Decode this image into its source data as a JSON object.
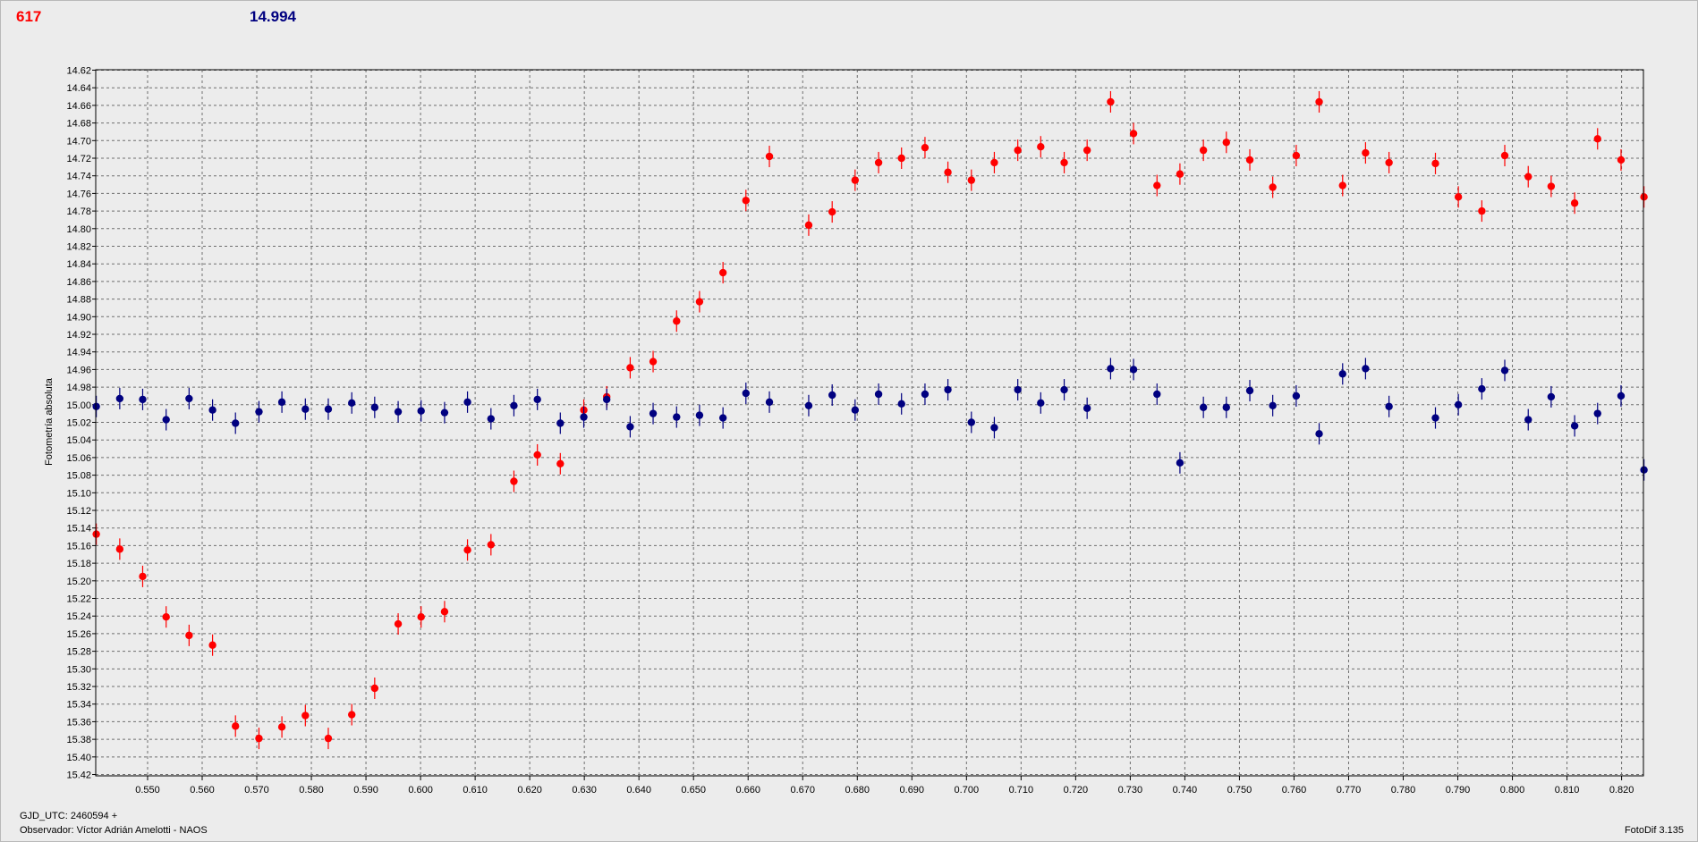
{
  "header": {
    "star_label": "617",
    "mag_label": "14.994",
    "star_color": "#ff0000",
    "mag_color": "#000080"
  },
  "footer": {
    "gjd": "GJD_UTC: 2460594 +",
    "observer": "Observador: Víctor Adrián Amelotti - NAOS",
    "software": "FotoDif 3.135"
  },
  "chart_data": {
    "type": "scatter",
    "title": "",
    "xlabel": "",
    "ylabel": "Fotometría absoluta",
    "xlim": [
      0.5405,
      0.824
    ],
    "ylim": [
      15.4215,
      14.6195
    ],
    "y_inverted": true,
    "grid": true,
    "x_ticks": [
      "0.550",
      "0.560",
      "0.570",
      "0.580",
      "0.590",
      "0.600",
      "0.610",
      "0.620",
      "0.630",
      "0.640",
      "0.650",
      "0.660",
      "0.670",
      "0.680",
      "0.690",
      "0.700",
      "0.710",
      "0.720",
      "0.730",
      "0.740",
      "0.750",
      "0.760",
      "0.770",
      "0.780",
      "0.790",
      "0.800",
      "0.810",
      "0.820"
    ],
    "y_ticks": [
      "14.62",
      "14.64",
      "14.66",
      "14.68",
      "14.70",
      "14.72",
      "14.74",
      "14.76",
      "14.78",
      "14.80",
      "14.82",
      "14.84",
      "14.86",
      "14.88",
      "14.90",
      "14.92",
      "14.94",
      "14.96",
      "14.98",
      "15.00",
      "15.02",
      "15.04",
      "15.06",
      "15.08",
      "15.10",
      "15.12",
      "15.14",
      "15.16",
      "15.18",
      "15.20",
      "15.22",
      "15.24",
      "15.26",
      "15.28",
      "15.30",
      "15.32",
      "15.34",
      "15.36",
      "15.38",
      "15.40",
      "15.42"
    ],
    "series": [
      {
        "color": "#ff0000",
        "x": [
          0.5406,
          0.5449,
          0.5491,
          0.5534,
          0.5576,
          0.5619,
          0.5661,
          0.5704,
          0.5746,
          0.5789,
          0.5831,
          0.5874,
          0.5916,
          0.5959,
          0.6001,
          0.6044,
          0.6086,
          0.6129,
          0.6171,
          0.6214,
          0.6256,
          0.6299,
          0.6341,
          0.6384,
          0.6426,
          0.6469,
          0.6511,
          0.6554,
          0.6596,
          0.6639,
          0.6711,
          0.6754,
          0.6796,
          0.6839,
          0.6881,
          0.6924,
          0.6966,
          0.7009,
          0.7051,
          0.7094,
          0.7136,
          0.7179,
          0.7221,
          0.7264,
          0.7306,
          0.7349,
          0.7391,
          0.7434,
          0.7476,
          0.7519,
          0.7561,
          0.7604,
          0.7646,
          0.7689,
          0.7731,
          0.7774,
          0.7859,
          0.7901,
          0.7944,
          0.7986,
          0.8029,
          0.8071,
          0.8114,
          0.8156,
          0.8199,
          0.8241
        ],
        "y": [
          15.147,
          15.164,
          15.195,
          15.241,
          15.262,
          15.273,
          15.365,
          15.379,
          15.366,
          15.353,
          15.379,
          15.352,
          15.322,
          15.249,
          15.241,
          15.235,
          15.165,
          15.159,
          15.087,
          15.057,
          15.067,
          15.006,
          14.991,
          14.958,
          14.951,
          14.905,
          14.883,
          14.85,
          14.768,
          14.718,
          14.796,
          14.781,
          14.745,
          14.725,
          14.72,
          14.708,
          14.736,
          14.745,
          14.725,
          14.711,
          14.707,
          14.725,
          14.711,
          14.656,
          14.692,
          14.751,
          14.738,
          14.711,
          14.702,
          14.722,
          14.753,
          14.717,
          14.656,
          14.751,
          14.714,
          14.725,
          14.726,
          14.764,
          14.78,
          14.717,
          14.741,
          14.752,
          14.771,
          14.698,
          14.722,
          14.764
        ]
      },
      {
        "color": "#000080",
        "x": [
          0.5406,
          0.5449,
          0.5491,
          0.5534,
          0.5576,
          0.5619,
          0.5661,
          0.5704,
          0.5746,
          0.5789,
          0.5831,
          0.5874,
          0.5916,
          0.5959,
          0.6001,
          0.6044,
          0.6086,
          0.6129,
          0.6171,
          0.6214,
          0.6256,
          0.6299,
          0.6341,
          0.6384,
          0.6426,
          0.6469,
          0.6511,
          0.6554,
          0.6596,
          0.6639,
          0.6711,
          0.6754,
          0.6796,
          0.6839,
          0.6881,
          0.6924,
          0.6966,
          0.7009,
          0.7051,
          0.7094,
          0.7136,
          0.7179,
          0.7221,
          0.7264,
          0.7306,
          0.7349,
          0.7391,
          0.7434,
          0.7476,
          0.7519,
          0.7561,
          0.7604,
          0.7646,
          0.7689,
          0.7731,
          0.7774,
          0.7859,
          0.7901,
          0.7944,
          0.7986,
          0.8029,
          0.8071,
          0.8114,
          0.8156,
          0.8199,
          0.8241
        ],
        "y": [
          15.002,
          14.993,
          14.994,
          15.017,
          14.993,
          15.006,
          15.021,
          15.008,
          14.997,
          15.005,
          15.005,
          14.998,
          15.003,
          15.008,
          15.007,
          15.009,
          14.997,
          15.016,
          15.001,
          14.994,
          15.021,
          15.014,
          14.994,
          15.025,
          15.01,
          15.014,
          15.012,
          15.015,
          14.987,
          14.997,
          15.001,
          14.989,
          15.006,
          14.988,
          14.999,
          14.988,
          14.983,
          15.02,
          15.026,
          14.983,
          14.998,
          14.983,
          15.004,
          14.959,
          14.96,
          14.988,
          15.066,
          15.003,
          15.003,
          14.984,
          15.001,
          14.99,
          15.033,
          14.965,
          14.959,
          15.002,
          15.015,
          15.0,
          14.982,
          14.961,
          15.017,
          14.991,
          15.024,
          15.01,
          14.99,
          15.074
        ]
      }
    ]
  }
}
